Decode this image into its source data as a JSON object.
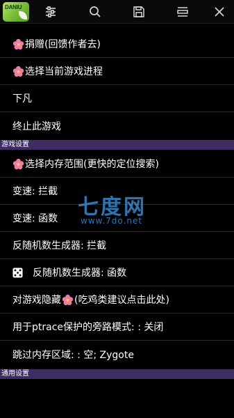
{
  "toolbar": {
    "logo_text": "DANIU",
    "icons": [
      "sliders-icon",
      "search-icon",
      "save-icon",
      "list-edit-icon",
      "close-icon"
    ]
  },
  "menu": {
    "donate": "捐赠(回馈作者去)",
    "select_process": "选择当前游戏进程",
    "xiafan": "下凡",
    "terminate": "终止此游戏"
  },
  "sections": {
    "game_settings": "游戏设置",
    "general_settings": "通用设置"
  },
  "game_settings_items": {
    "memory_range": "选择内存范围(更快的定位搜索)",
    "speed_intercept": "变速: 拦截",
    "speed_function": "变速: 函数",
    "anti_random_intercept": "反随机数生成器: 拦截",
    "anti_random_function": "反随机数生成器: 函数",
    "hide_prefix": "对游戏隐藏",
    "hide_suffix": "(吃鸡类建议点击此处)",
    "ptrace_bypass": "用于ptrace保护的旁路模式: : 关闭",
    "skip_memory": "跳过内存区域: : 空; Zygote"
  },
  "watermark": {
    "title": "七度网",
    "url": "www.7do.net"
  },
  "colors": {
    "section_bg": "#3d2d63",
    "watermark": "#3e94e0",
    "flower": "#f07aa8"
  }
}
